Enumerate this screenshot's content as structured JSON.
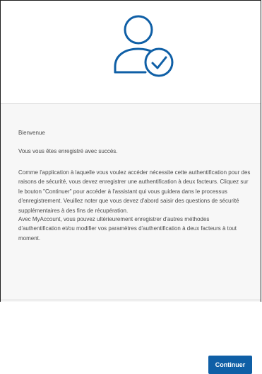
{
  "hero": {
    "icon": "user-check-icon",
    "icon_color": "#0f5fa6"
  },
  "content": {
    "greeting": "Bienvenue",
    "success": "Vous vous êtes enregistré avec succès.",
    "paragraph1": "Comme l'application à laquelle vous voulez accéder nécessite cette authentification pour des raisons de sécurité, vous devez enregistrer une authentification à deux facteurs. Cliquez sur le bouton \"Continuer\" pour accéder à l'assistant qui vous guidera dans le processus d'enregistrement. Veuillez noter que vous devez d'abord saisir des questions de sécurité supplémentaires à des fins de récupération.",
    "paragraph2": "Avec MyAccount, vous pouvez ultérieurement enregistrer d'autres méthodes d'authentification et/ou modifier vos paramètres d'authentification à deux facteurs à tout moment."
  },
  "actions": {
    "continue_label": "Continuer",
    "button_color": "#0f5fa6"
  }
}
